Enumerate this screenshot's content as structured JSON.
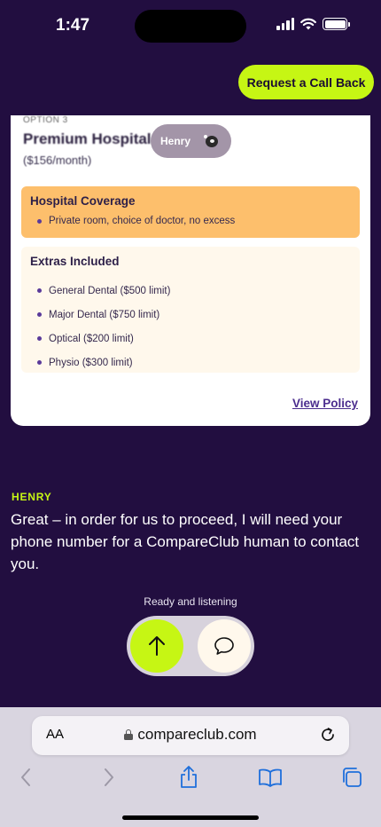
{
  "status_bar": {
    "time": "1:47"
  },
  "header": {
    "callback_label": "Request a Call Back"
  },
  "policy_card": {
    "option_tag": "OPTION 3",
    "title": "Premium Hospital",
    "price": "($156/month)",
    "agent_badge": "Henry",
    "hospital_coverage": {
      "title": "Hospital Coverage",
      "items": [
        "Private room, choice of doctor, no excess"
      ]
    },
    "extras": {
      "title": "Extras Included",
      "items": [
        "General Dental ($500 limit)",
        "Major Dental ($750 limit)",
        "Optical ($200 limit)",
        "Physio ($300 limit)"
      ]
    },
    "view_policy_label": "View Policy"
  },
  "chat": {
    "agent_name": "HENRY",
    "message": "Great – in order for us to proceed, I will need your phone number for a CompareClub human to contact you.",
    "listen_status": "Ready and listening"
  },
  "browser": {
    "aa_label": "AA",
    "url": "compareclub.com"
  },
  "colors": {
    "background": "#220e40",
    "accent": "#c6f614",
    "coverage_bg": "#fdbf6c",
    "extras_bg": "#fff8ec"
  }
}
